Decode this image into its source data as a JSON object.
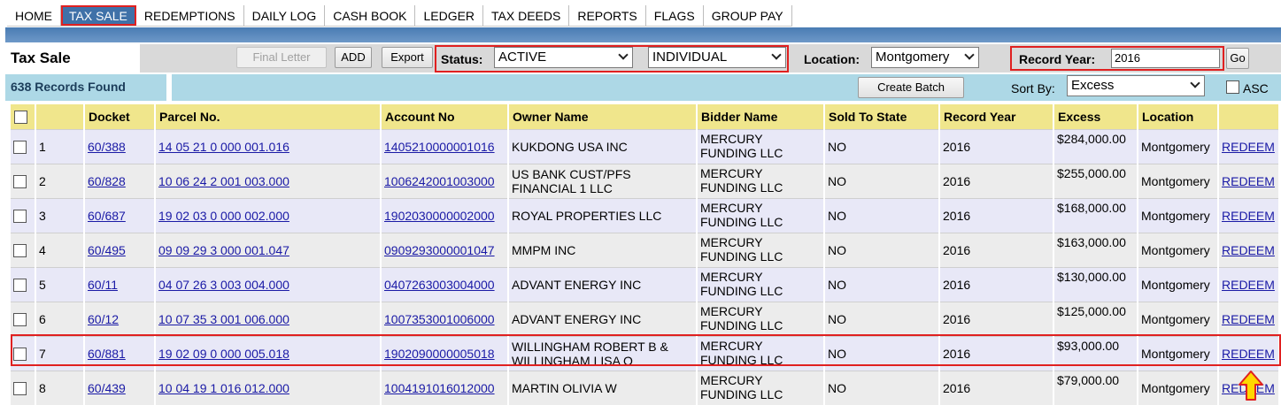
{
  "nav": {
    "items": [
      {
        "label": "HOME",
        "active": false
      },
      {
        "label": "TAX SALE",
        "active": true
      },
      {
        "label": "REDEMPTIONS",
        "active": false
      },
      {
        "label": "DAILY LOG",
        "active": false
      },
      {
        "label": "CASH BOOK",
        "active": false
      },
      {
        "label": "LEDGER",
        "active": false
      },
      {
        "label": "TAX DEEDS",
        "active": false
      },
      {
        "label": "REPORTS",
        "active": false
      },
      {
        "label": "FLAGS",
        "active": false
      },
      {
        "label": "GROUP PAY",
        "active": false
      }
    ]
  },
  "toolbar": {
    "title": "Tax Sale",
    "final_letter_label": "Final Letter",
    "add_label": "ADD",
    "export_label": "Export",
    "status_label": "Status:",
    "status_value": "ACTIVE",
    "type_value": "INDIVIDUAL",
    "location_label": "Location:",
    "location_value": "Montgomery",
    "record_year_label": "Record Year:",
    "record_year_value": "2016",
    "go_label": "Go"
  },
  "records_bar": {
    "count_text": "638 Records Found",
    "create_batch_label": "Create Batch",
    "sort_by_label": "Sort By:",
    "sort_by_value": "Excess",
    "asc_label": "ASC"
  },
  "table": {
    "headers": [
      "Docket",
      "Parcel No.",
      "Account No",
      "Owner Name",
      "Bidder Name",
      "Sold To State",
      "Record Year",
      "Excess",
      "Location"
    ],
    "rows": [
      {
        "num": "1",
        "docket": "60/388",
        "parcel": "14 05 21 0 000 001.016",
        "account": "1405210000001016",
        "owner": "KUKDONG USA INC",
        "bidder": "MERCURY FUNDING LLC",
        "sold_to_state": "NO",
        "record_year": "2016",
        "excess": "$284,000.00",
        "location": "Montgomery",
        "action": "REDEEM"
      },
      {
        "num": "2",
        "docket": "60/828",
        "parcel": "10 06 24 2 001 003.000",
        "account": "1006242001003000",
        "owner": "US BANK CUST/PFS FINANCIAL 1 LLC",
        "bidder": "MERCURY FUNDING LLC",
        "sold_to_state": "NO",
        "record_year": "2016",
        "excess": "$255,000.00",
        "location": "Montgomery",
        "action": "REDEEM"
      },
      {
        "num": "3",
        "docket": "60/687",
        "parcel": "19 02 03 0 000 002.000",
        "account": "1902030000002000",
        "owner": "ROYAL PROPERTIES LLC",
        "bidder": "MERCURY FUNDING LLC",
        "sold_to_state": "NO",
        "record_year": "2016",
        "excess": "$168,000.00",
        "location": "Montgomery",
        "action": "REDEEM"
      },
      {
        "num": "4",
        "docket": "60/495",
        "parcel": "09 09 29 3 000 001.047",
        "account": "0909293000001047",
        "owner": "MMPM INC",
        "bidder": "MERCURY FUNDING LLC",
        "sold_to_state": "NO",
        "record_year": "2016",
        "excess": "$163,000.00",
        "location": "Montgomery",
        "action": "REDEEM"
      },
      {
        "num": "5",
        "docket": "60/11",
        "parcel": "04 07 26 3 003 004.000",
        "account": "0407263003004000",
        "owner": "ADVANT ENERGY INC",
        "bidder": "MERCURY FUNDING LLC",
        "sold_to_state": "NO",
        "record_year": "2016",
        "excess": "$130,000.00",
        "location": "Montgomery",
        "action": "REDEEM"
      },
      {
        "num": "6",
        "docket": "60/12",
        "parcel": "10 07 35 3 001 006.000",
        "account": "1007353001006000",
        "owner": "ADVANT ENERGY INC",
        "bidder": "MERCURY FUNDING LLC",
        "sold_to_state": "NO",
        "record_year": "2016",
        "excess": "$125,000.00",
        "location": "Montgomery",
        "action": "REDEEM"
      },
      {
        "num": "7",
        "docket": "60/881",
        "parcel": "19 02 09 0 000 005.018",
        "account": "1902090000005018",
        "owner": "WILLINGHAM ROBERT B & WILLINGHAM LISA O",
        "bidder": "MERCURY FUNDING LLC",
        "sold_to_state": "NO",
        "record_year": "2016",
        "excess": "$93,000.00",
        "location": "Montgomery",
        "action": "REDEEM"
      },
      {
        "num": "8",
        "docket": "60/439",
        "parcel": "10 04 19 1 016 012.000",
        "account": "1004191016012000",
        "owner": "MARTIN OLIVIA W",
        "bidder": "MERCURY FUNDING LLC",
        "sold_to_state": "NO",
        "record_year": "2016",
        "excess": "$79,000.00",
        "location": "Montgomery",
        "action": "REDEEM"
      }
    ]
  },
  "colors": {
    "nav_active": "#3f71a8",
    "header_bg": "#f0e68c",
    "records_bar_bg": "#add8e6",
    "highlight_border": "#e02020",
    "link": "#1a1aa6",
    "arrow_fill": "#ffd700"
  },
  "annotations": {
    "arrow_icon": "up-arrow-icon"
  }
}
